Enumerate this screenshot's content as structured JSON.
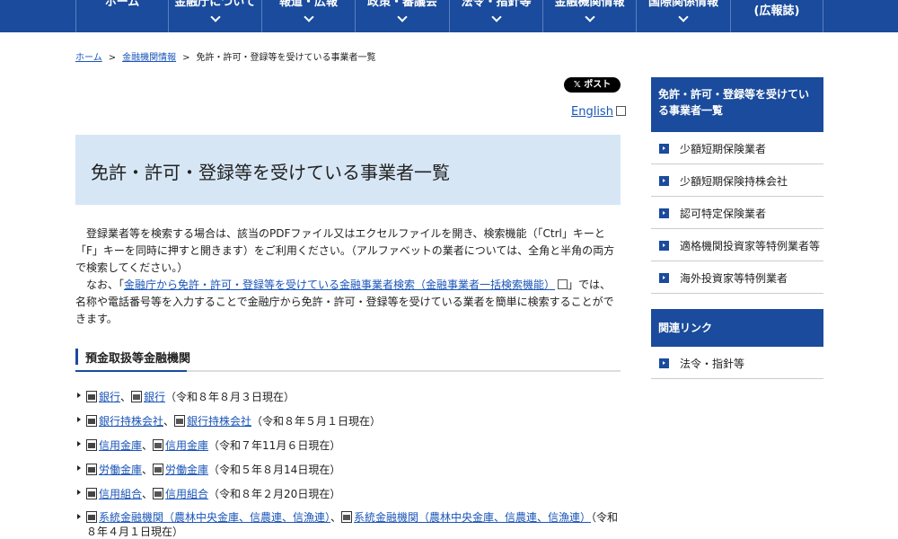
{
  "nav": {
    "items": [
      {
        "label": "ホーム"
      },
      {
        "label": "金融庁について"
      },
      {
        "label": "報道・広報"
      },
      {
        "label": "政策・審議会"
      },
      {
        "label": "法令・指針等"
      },
      {
        "label": "金融機関情報"
      },
      {
        "label": "国際関係情報"
      }
    ],
    "last_label": "(広報誌)"
  },
  "breadcrumb": {
    "home": "ホーム",
    "parent": "金融機関情報",
    "sep": ">",
    "current": "免許・許可・登録等を受けている事業者一覧"
  },
  "share": {
    "post_label": "𝕏 ポスト"
  },
  "english_label": "English",
  "page_title": "免許・許可・登録等を受けている事業者一覧",
  "intro": {
    "p1": "登録業者等を検索する場合は、該当のPDFファイル又はエクセルファイルを開き、検索機能（「Ctrl」キーと「F」キーを同時に押すと開きます）をご利用ください。（アルファベットの業者については、全角と半角の両方で検索してください。）",
    "p2_before": "なお、「",
    "p2_link": "金融庁から免許・許可・登録等を受けている金融事業者検索（金融事業者一括検索機能）",
    "p2_after": "」では、名称や電話番号等を入力することで金融庁から免許・許可・登録等を受けている業者を簡単に検索することができます。"
  },
  "section_title": "預金取扱等金融機関",
  "entries": [
    {
      "pdf": "銀行",
      "xls": "銀行",
      "date": "（令和８年８月３日現在）"
    },
    {
      "pdf": "銀行持株会社",
      "xls": "銀行持株会社",
      "date": "（令和８年５月１日現在）"
    },
    {
      "pdf": "信用金庫",
      "xls": "信用金庫",
      "date": "（令和７年11月６日現在）"
    },
    {
      "pdf": "労働金庫",
      "xls": "労働金庫",
      "date": "（令和５年８月14日現在）"
    },
    {
      "pdf": "信用組合",
      "xls": "信用組合",
      "date": "（令和８年２月20日現在）"
    },
    {
      "pdf": "系統金融機関（農林中央金庫、信農連、信漁連）",
      "xls": "系統金融機関（農林中央金庫、信農連、信漁連）",
      "date": "（令和８年４月１日現在）"
    }
  ],
  "list_sep": "、",
  "sidebar": {
    "heading": "免許・許可・登録等を受けている事業者一覧",
    "items": [
      {
        "label": "少額短期保険業者"
      },
      {
        "label": "少額短期保険持株会社"
      },
      {
        "label": "認可特定保険業者"
      },
      {
        "label": "適格機関投資家等特例業者等"
      },
      {
        "label": "海外投資家等特例業者"
      }
    ],
    "related_heading": "関連リンク",
    "related_items": [
      {
        "label": "法令・指針等"
      }
    ]
  }
}
